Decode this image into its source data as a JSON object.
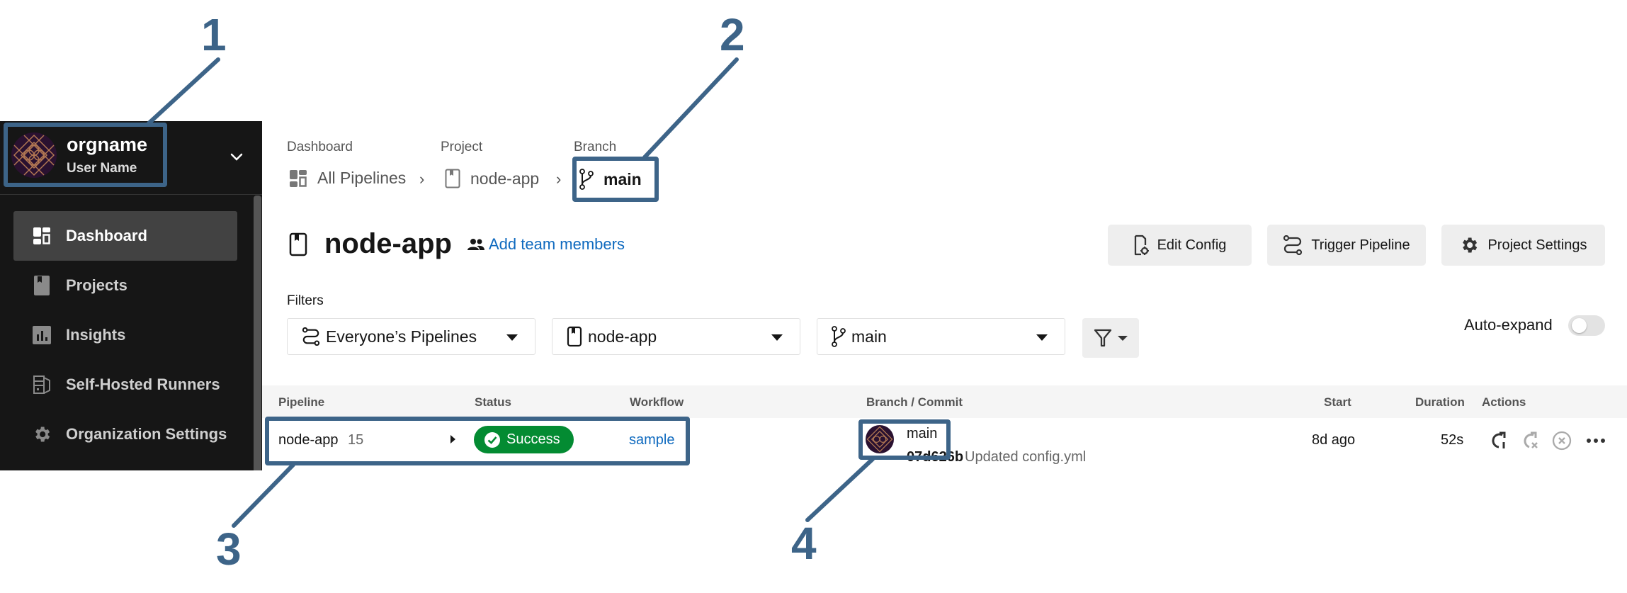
{
  "sidebar": {
    "org_name": "orgname",
    "user_name": "User Name",
    "items": [
      {
        "label": "Dashboard",
        "icon": "dashboard-icon",
        "active": true
      },
      {
        "label": "Projects",
        "icon": "projects-icon",
        "active": false
      },
      {
        "label": "Insights",
        "icon": "insights-icon",
        "active": false
      },
      {
        "label": "Self-Hosted Runners",
        "icon": "runners-icon",
        "active": false
      },
      {
        "label": "Organization Settings",
        "icon": "gear-icon",
        "active": false
      }
    ]
  },
  "breadcrumb": {
    "labels": [
      "Dashboard",
      "Project",
      "Branch"
    ],
    "items": [
      "All Pipelines",
      "node-app",
      "main"
    ]
  },
  "header": {
    "title": "node-app",
    "add_team_label": "Add team members",
    "buttons": {
      "edit_config": "Edit Config",
      "trigger_pipeline": "Trigger Pipeline",
      "project_settings": "Project Settings"
    }
  },
  "filters": {
    "label": "Filters",
    "pipelines_select": "Everyone’s Pipelines",
    "project_select": "node-app",
    "branch_select": "main",
    "auto_expand_label": "Auto-expand",
    "auto_expand_on": false
  },
  "table": {
    "columns": [
      "Pipeline",
      "Status",
      "Workflow",
      "Branch / Commit",
      "Start",
      "Duration",
      "Actions"
    ],
    "rows": [
      {
        "pipeline": "node-app",
        "number": "15",
        "status": "Success",
        "workflow": "sample",
        "branch": "main",
        "commit_hash": "07d626b",
        "commit_message": "Updated config.yml",
        "start": "8d ago",
        "duration": "52s"
      }
    ]
  },
  "colors": {
    "success": "#038b32",
    "link": "#0f6abf",
    "sidebar_bg": "#161616",
    "annotation": "#3d6488"
  },
  "annotations": [
    "1",
    "2",
    "3",
    "4"
  ]
}
